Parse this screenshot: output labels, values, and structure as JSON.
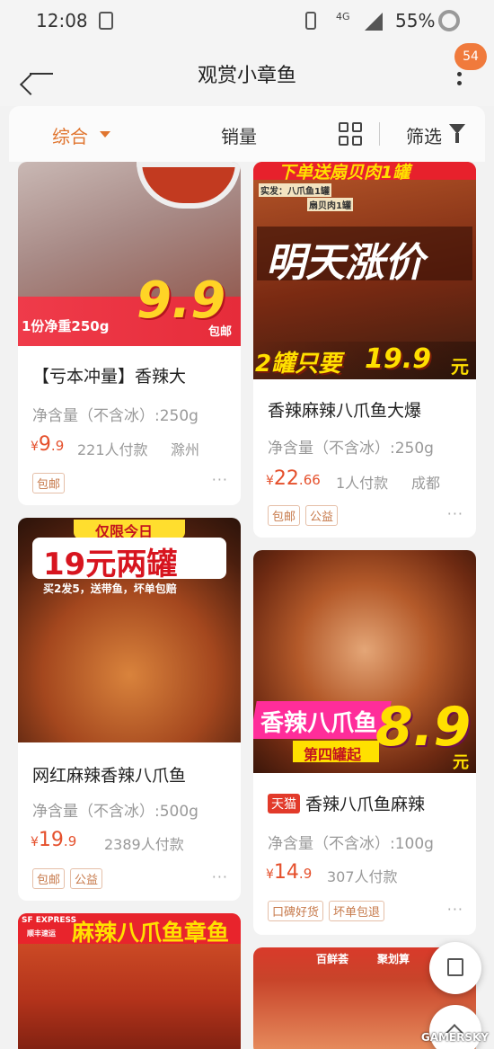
{
  "status_bar": {
    "time": "12:08",
    "network": "4G",
    "battery": "55%"
  },
  "header": {
    "title": "观赏小章鱼",
    "badge": "54"
  },
  "filter_bar": {
    "sort_default": "综合",
    "sales": "销量",
    "filter": "筛选"
  },
  "products": [
    {
      "title": "【亏本冲量】香辣大",
      "spec": "净含量（不含冰）:250g",
      "price_int": "9",
      "price_dec": ".9",
      "payers": "221人付款",
      "location": "滁州",
      "tags": [
        "包邮"
      ],
      "banner": {
        "weight": "1份净重250g",
        "price": "9.9",
        "suffix": "包邮"
      }
    },
    {
      "title": "香辣麻辣八爪鱼大爆",
      "spec": "净含量（不含冰）:250g",
      "price_int": "22",
      "price_dec": ".66",
      "payers": "1人付款",
      "location": "成都",
      "tags": [
        "包邮",
        "公益"
      ],
      "banner": {
        "top": "下单送扇贝肉1罐",
        "sub1": "实发：八爪鱼1罐",
        "sub2": "扇贝肉1罐",
        "main": "明天涨价",
        "bottom_a": "2罐只要",
        "bottom_b": "19.9",
        "bottom_c": "元"
      }
    },
    {
      "title": "网红麻辣香辣八爪鱼",
      "spec": "净含量（不含冰）:500g",
      "price_int": "19",
      "price_dec": ".9",
      "payers": "2389人付款",
      "location": "",
      "tags": [
        "包邮",
        "公益"
      ],
      "banner": {
        "ribbon": "仅限今日",
        "main": "19元两罐",
        "sub": "买2发5，送带鱼，坏单包赔"
      }
    },
    {
      "badge": "天猫",
      "title": "香辣八爪鱼麻辣",
      "spec": "净含量（不含冰）:100g",
      "price_int": "14",
      "price_dec": ".9",
      "payers": "307人付款",
      "location": "",
      "tags": [
        "口碑好货",
        "坏单包退"
      ],
      "banner": {
        "name": "香辣八爪鱼",
        "sub": "第四罐起",
        "price": "8.9",
        "unit": "元"
      }
    },
    {
      "banner": {
        "logo": "SF EXPRESS",
        "logo_sub": "顺丰速运",
        "main": "麻辣八爪鱼章鱼"
      }
    },
    {
      "banner": {
        "brand": "百鲜荟",
        "promo": "聚划算"
      }
    }
  ],
  "more_label": "···",
  "watermark": "GAMERSKY"
}
